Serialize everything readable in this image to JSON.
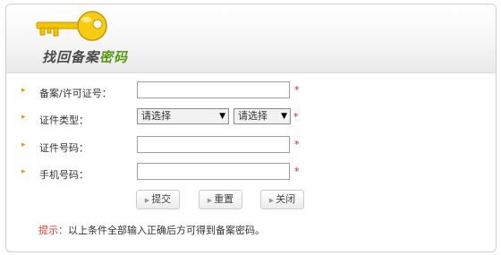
{
  "header": {
    "title_main": "找回备案",
    "title_accent": "密码",
    "key_icon": "key-icon",
    "colors": {
      "accent": "#5a9a1a",
      "key": "#f3c400"
    }
  },
  "form": {
    "rows": [
      {
        "label": "备案/许可证号：",
        "value": ""
      },
      {
        "label": "证件类型："
      },
      {
        "label": "证件号码：",
        "value": ""
      },
      {
        "label": "手机号码：",
        "value": ""
      }
    ],
    "required_mark": "*",
    "cert_type_select": "请选择",
    "cert_subtype_select": "请选择"
  },
  "buttons": {
    "submit": "提交",
    "reset": "重置",
    "close": "关闭"
  },
  "hint": {
    "label": "提示：",
    "text": "以上条件全部输入正确后方可得到备案密码。"
  }
}
